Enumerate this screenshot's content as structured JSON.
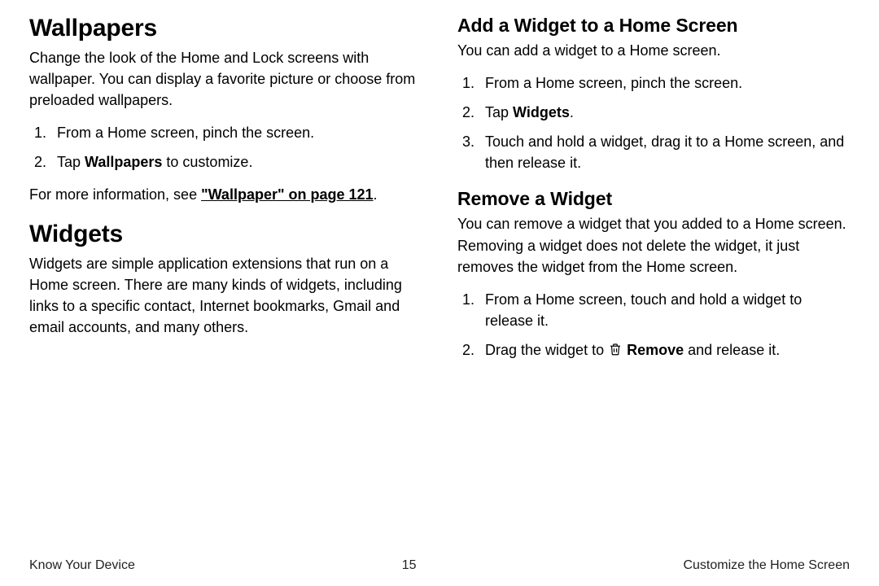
{
  "left": {
    "wallpapers": {
      "heading": "Wallpapers",
      "intro": "Change the look of the Home and Lock screens with wallpaper. You can display a favorite picture or choose from preloaded wallpapers.",
      "step1": "From a Home screen, pinch the screen.",
      "step2_pre": "Tap ",
      "step2_bold": "Wallpapers",
      "step2_post": " to customize.",
      "more_pre": "For more information, see ",
      "more_link": "\"Wallpaper\" on page 121",
      "more_post": "."
    },
    "widgets": {
      "heading": "Widgets",
      "intro": "Widgets are simple application extensions that run on a Home screen. There are many kinds of widgets, including links to a specific contact, Internet bookmarks, Gmail and email accounts, and many others."
    }
  },
  "right": {
    "add": {
      "heading": "Add a Widget to a Home Screen",
      "intro": "You can add a widget to a Home screen.",
      "step1": "From a Home screen, pinch the screen.",
      "step2_pre": "Tap ",
      "step2_bold": "Widgets",
      "step2_post": ".",
      "step3": "Touch and hold a widget, drag it to a Home screen, and then release it."
    },
    "remove": {
      "heading": "Remove a Widget",
      "intro": "You can remove a widget that you added to a Home screen. Removing a widget does not delete the widget, it just removes the widget from the Home screen.",
      "step1": "From a Home screen, touch and hold a widget to release it.",
      "step2_pre": "Drag the widget to ",
      "step2_bold": "Remove",
      "step2_post": " and release it."
    }
  },
  "footer": {
    "left": "Know Your Device",
    "center": "15",
    "right": "Customize the Home Screen"
  }
}
